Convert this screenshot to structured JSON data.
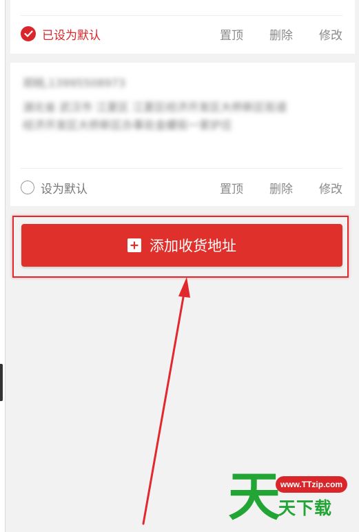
{
  "address_list": [
    {
      "is_default": true,
      "default_label": "已设为默认",
      "actions": {
        "top": "置顶",
        "delete": "删除",
        "edit": "修改"
      }
    },
    {
      "is_default": false,
      "name_phone": "郑桃,13995508973",
      "address": "湖北省 武汉市 江夏区 江夏区经济开发区大桥新区街道经济开发区大桥新区办事处金螺街一家炉庄",
      "default_label": "设为默认",
      "actions": {
        "top": "置顶",
        "delete": "删除",
        "edit": "修改"
      }
    }
  ],
  "add_button": {
    "label": "添加收货地址"
  },
  "watermark": {
    "big_char": "天",
    "small_text": "天下载",
    "url": "www.TTzip.com"
  },
  "colors": {
    "accent": "#e0302b",
    "watermark_green": "#22a535",
    "background": "#f2f2f2"
  },
  "icons": {
    "checked": "check-circle-icon",
    "unchecked": "radio-icon",
    "add": "plus-square-icon"
  }
}
